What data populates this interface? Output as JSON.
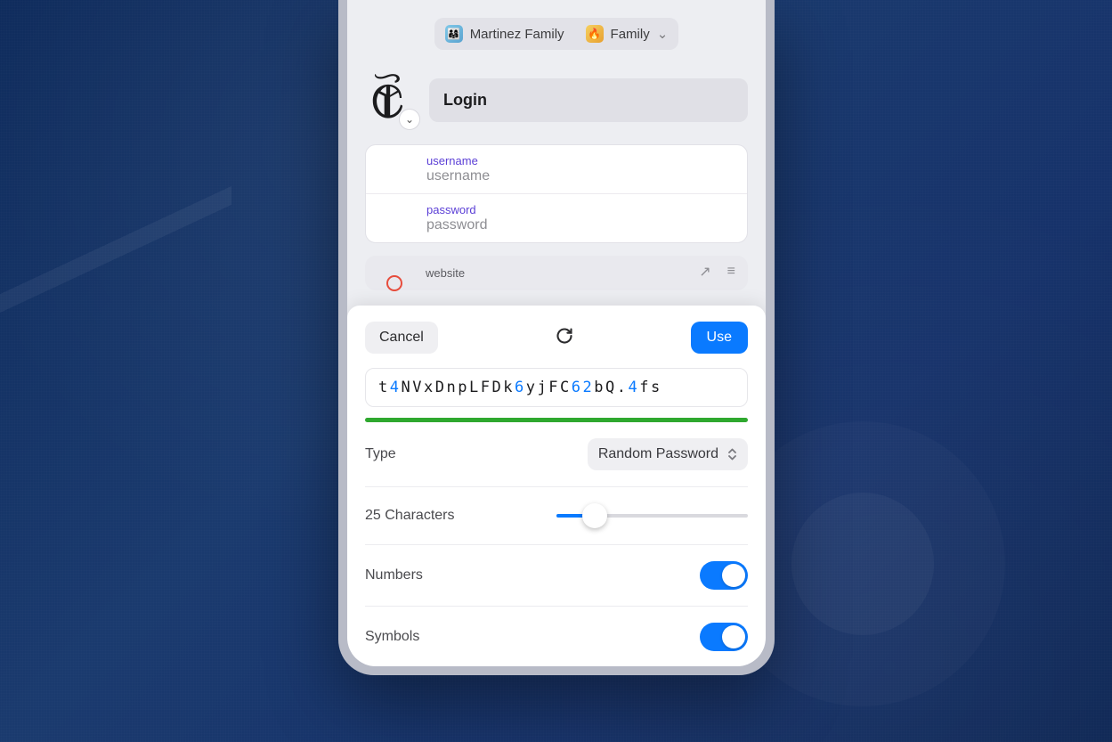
{
  "vault": {
    "group": "Martinez Family",
    "shared": "Family"
  },
  "item": {
    "title": "Login",
    "fields": {
      "username": {
        "label": "username",
        "placeholder": "username"
      },
      "password": {
        "label": "password",
        "placeholder": "password"
      },
      "website": {
        "label": "website"
      }
    }
  },
  "generator": {
    "cancel_label": "Cancel",
    "use_label": "Use",
    "password_chars": [
      {
        "c": "t",
        "k": "l"
      },
      {
        "c": "4",
        "k": "n"
      },
      {
        "c": "N",
        "k": "l"
      },
      {
        "c": "V",
        "k": "l"
      },
      {
        "c": "x",
        "k": "l"
      },
      {
        "c": "D",
        "k": "l"
      },
      {
        "c": "n",
        "k": "l"
      },
      {
        "c": "p",
        "k": "l"
      },
      {
        "c": "L",
        "k": "l"
      },
      {
        "c": "F",
        "k": "l"
      },
      {
        "c": "D",
        "k": "l"
      },
      {
        "c": "k",
        "k": "l"
      },
      {
        "c": "6",
        "k": "n"
      },
      {
        "c": "y",
        "k": "l"
      },
      {
        "c": "j",
        "k": "l"
      },
      {
        "c": "F",
        "k": "l"
      },
      {
        "c": "C",
        "k": "l"
      },
      {
        "c": "6",
        "k": "n"
      },
      {
        "c": "2",
        "k": "n"
      },
      {
        "c": "b",
        "k": "l"
      },
      {
        "c": "Q",
        "k": "l"
      },
      {
        "c": ".",
        "k": "s"
      },
      {
        "c": "4",
        "k": "n"
      },
      {
        "c": "f",
        "k": "l"
      },
      {
        "c": "s",
        "k": "l"
      }
    ],
    "type_label": "Type",
    "type_value": "Random Password",
    "length_label": "25 Characters",
    "length_value": 25,
    "numbers_label": "Numbers",
    "numbers_on": true,
    "symbols_label": "Symbols",
    "symbols_on": true
  }
}
